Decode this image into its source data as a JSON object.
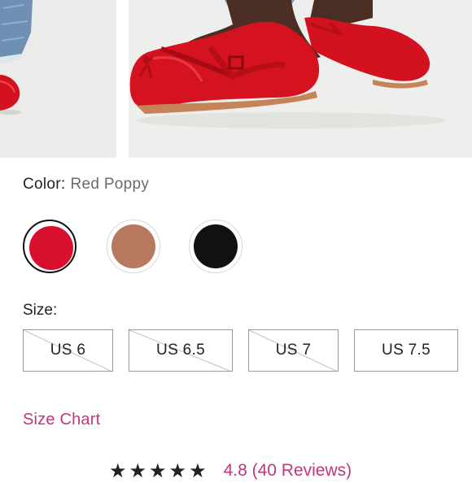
{
  "gallery": {
    "images": [
      {
        "name": "red-flat-partial-view"
      },
      {
        "name": "red-ballet-flats-worn"
      }
    ]
  },
  "color": {
    "label": "Color:",
    "selected": "Red Poppy",
    "swatches": [
      {
        "name": "Red Poppy",
        "hex": "#d8102e",
        "selected": true
      },
      {
        "name": "Copper",
        "hex": "#b97860",
        "selected": false
      },
      {
        "name": "Black",
        "hex": "#111111",
        "selected": false
      }
    ]
  },
  "size": {
    "label": "Size:",
    "options": [
      {
        "label": "US 6",
        "available": false
      },
      {
        "label": "US 6.5",
        "available": false
      },
      {
        "label": "US 7",
        "available": false
      },
      {
        "label": "US 7.5",
        "available": true
      }
    ]
  },
  "size_chart_link": "Size Chart",
  "rating": {
    "stars": 5,
    "text": "4.8 (40 Reviews)",
    "star_icon": "star-icon"
  },
  "colors": {
    "accent": "#c2367a",
    "text": "#222222",
    "muted": "#6b6b6b",
    "border": "#9a9a9a"
  }
}
